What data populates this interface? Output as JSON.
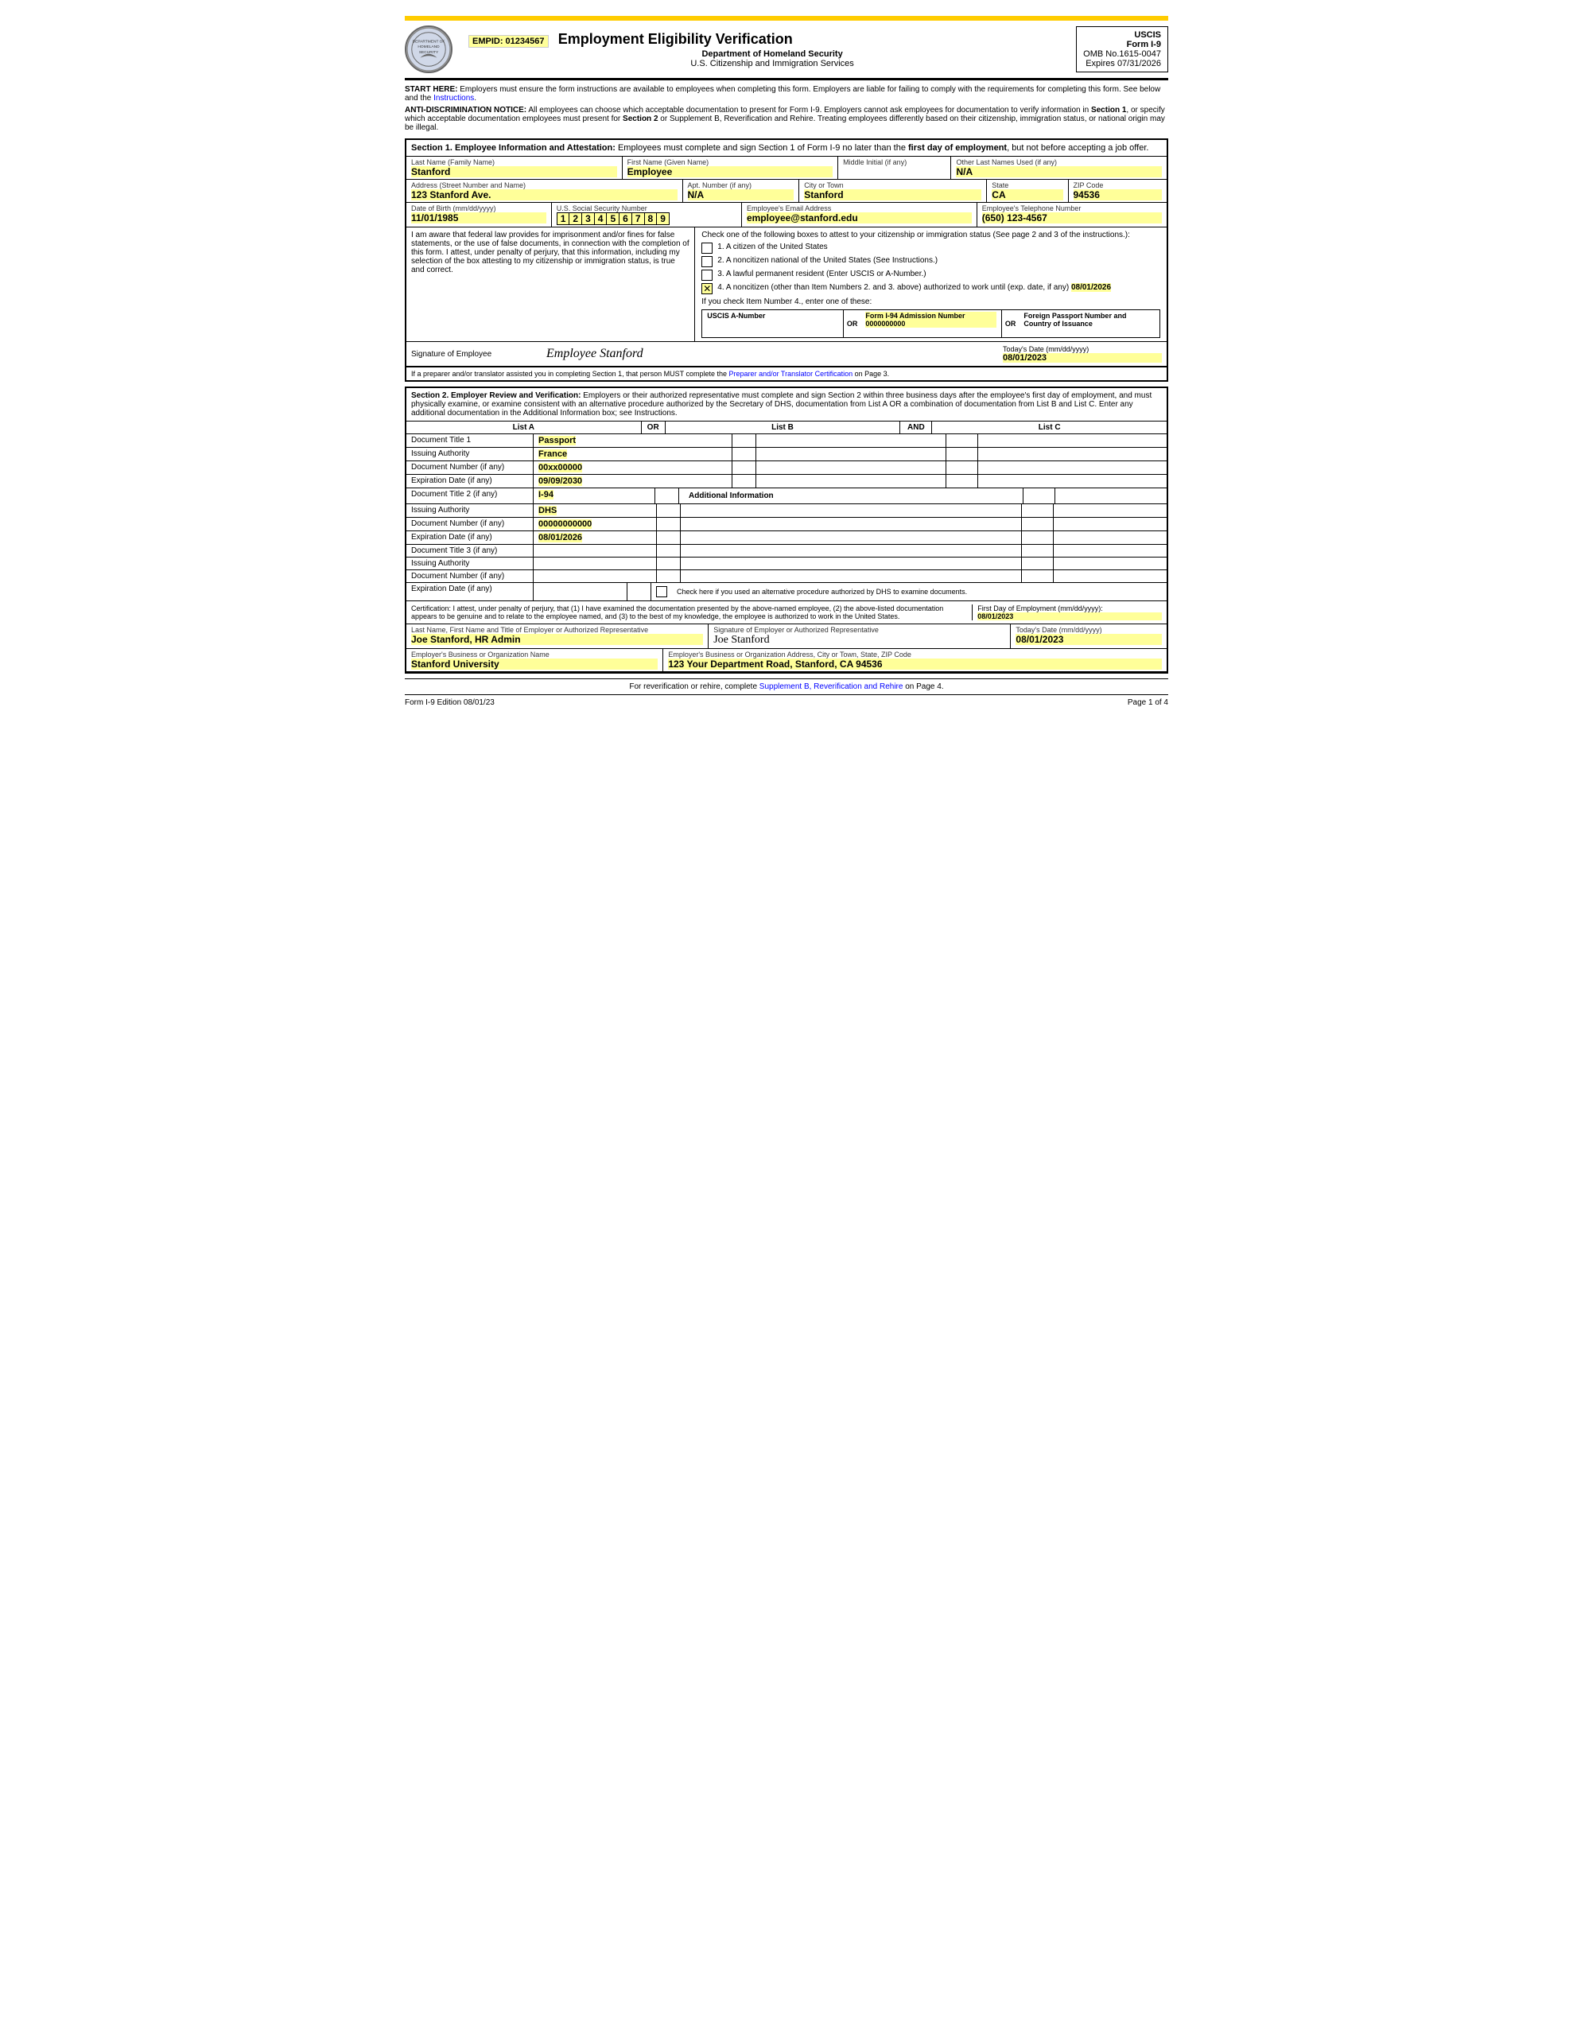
{
  "header": {
    "empid_label": "EMPID: 01234567",
    "title": "Employment Eligibility Verification",
    "dept": "Department of Homeland Security",
    "agency": "U.S. Citizenship and Immigration Services",
    "form_id": "USCIS",
    "form_name": "Form I-9",
    "omb": "OMB No.1615-0047",
    "expires": "Expires 07/31/2026"
  },
  "notices": {
    "start_here": "START HERE:  Employers must ensure the form instructions are available to employees when completing this form.  Employers are liable for failing to comply with the requirements for completing this form.  See below and the Instructions.",
    "anti_discrimination": "ANTI-DISCRIMINATION NOTICE:  All employees can choose which acceptable documentation to present for Form I-9.  Employers cannot ask employees for documentation to verify information in Section 1, or specify which acceptable documentation employees must present for Section 2 or Supplement B, Reverification and Rehire.  Treating employees differently based on their citizenship, immigration status, or national origin may be illegal."
  },
  "section1": {
    "header": "Section 1. Employee Information and Attestation:",
    "header_desc": "Employees must complete and sign Section 1 of Form I-9 no later than the first day of employment, but not before accepting a job offer.",
    "last_name_label": "Last Name (Family Name)",
    "last_name": "Stanford",
    "first_name_label": "First Name (Given Name)",
    "first_name": "Employee",
    "middle_initial_label": "Middle Initial (if any)",
    "middle_initial": "",
    "other_names_label": "Other Last Names Used (if any)",
    "other_names": "N/A",
    "address_label": "Address (Street Number and Name)",
    "address": "123 Stanford Ave.",
    "apt_label": "Apt. Number (if any)",
    "apt": "N/A",
    "city_label": "City or Town",
    "city": "Stanford",
    "state_label": "State",
    "state": "CA",
    "zip_label": "ZIP Code",
    "zip": "94536",
    "dob_label": "Date of Birth (mm/dd/yyyy)",
    "dob": "11/01/1985",
    "ssn_label": "U.S. Social Security Number",
    "ssn_digits": [
      "1",
      "2",
      "3",
      "4",
      "5",
      "6",
      "7",
      "8",
      "9"
    ],
    "email_label": "Employee's Email Address",
    "email": "employee@stanford.edu",
    "phone_label": "Employee's Telephone Number",
    "phone": "(650) 123-4567",
    "attest_left_text": "I am aware that federal law provides for imprisonment and/or fines for false statements, or the use of false documents, in connection with the completion of this form. I attest, under penalty of perjury, that this information, including my selection of the box attesting to my citizenship or immigration status, is true and correct.",
    "checkbox1": "1.  A citizen of the United States",
    "checkbox2": "2.  A noncitizen national of the United States (See Instructions.)",
    "checkbox3": "3.  A lawful permanent resident (Enter USCIS or A-Number.)",
    "checkbox4": "4.  A noncitizen (other than Item Numbers 2. and 3. above) authorized to work until (exp. date, if any)",
    "work_until": "08/01/2026",
    "if_check4": "If you check Item Number 4., enter one of these:",
    "uscis_label": "USCIS A-Number",
    "uscis_value": "",
    "form94_label": "Form I-94 Admission Number",
    "form94_value": "0000000000",
    "passport_label": "Foreign Passport Number and Country of Issuance",
    "passport_value": "",
    "or1": "OR",
    "or2": "OR",
    "sig_label": "Signature of Employee",
    "sig_value": "Employee Stanford",
    "sig_date_label": "Today's Date (mm/dd/yyyy)",
    "sig_date": "08/01/2023",
    "sig_note": "If a preparer and/or translator assisted you in completing Section 1, that person MUST complete the Preparer and/or Translator Certification on Page 3."
  },
  "section2": {
    "header": "Section 2. Employer Review and Verification:",
    "header_desc": "Employers or their authorized representative must complete and sign Section 2 within three business days after the employee's first day of employment, and must physically examine, or examine consistent with an alternative procedure authorized by the Secretary of DHS, documentation from List A OR a combination of documentation from List B and List C.  Enter any additional documentation in the Additional Information box; see Instructions.",
    "list_a_header": "List A",
    "list_b_header": "List B",
    "list_c_header": "List C",
    "or_label": "OR",
    "and_label": "AND",
    "doc1_title_label": "Document Title 1",
    "doc1_title": "Passport",
    "doc1_issuing_label": "Issuing Authority",
    "doc1_issuing": "France",
    "doc1_number_label": "Document Number (if any)",
    "doc1_number": "00xx00000",
    "doc1_expiry_label": "Expiration Date (if any)",
    "doc1_expiry": "09/09/2030",
    "doc2_title_label": "Document Title 2 (if any)",
    "doc2_title": "I-94",
    "doc2_issuing_label": "Issuing Authority",
    "doc2_issuing": "DHS",
    "doc2_number_label": "Document Number (if any)",
    "doc2_number": "00000000000",
    "doc2_expiry_label": "Expiration Date (if any)",
    "doc2_expiry": "08/01/2026",
    "doc3_title_label": "Document Title 3 (if any)",
    "doc3_title": "",
    "doc3_issuing_label": "Issuing Authority",
    "doc3_issuing": "",
    "doc3_number_label": "Document Number (if any)",
    "doc3_number": "",
    "doc3_expiry_label": "Expiration Date (if any)",
    "doc3_expiry": "",
    "additional_info_label": "Additional Information",
    "alt_procedure_text": "Check here if you used an alternative procedure authorized by DHS to examine documents.",
    "cert_text": "Certification: I attest, under penalty of perjury, that (1) I have examined the documentation presented by the above-named employee, (2) the above-listed documentation appears to be genuine and to relate to the employee named, and (3) to the best of my knowledge, the employee is authorized to work in the United States.",
    "first_day_label": "First Day of Employment (mm/dd/yyyy):",
    "first_day": "08/01/2023",
    "employer_name_label": "Last Name, First Name and Title of Employer or Authorized Representative",
    "employer_name": "Joe Stanford, HR Admin",
    "employer_sig_label": "Signature of Employer or Authorized Representative",
    "employer_sig": "Joe Stanford",
    "employer_date_label": "Today's Date (mm/dd/yyyy)",
    "employer_date": "08/01/2023",
    "org_name_label": "Employer's Business or Organization Name",
    "org_name": "Stanford University",
    "org_address_label": "Employer's Business or Organization Address, City or Town, State, ZIP Code",
    "org_address": "123 Your Department Road, Stanford, CA 94536"
  },
  "footer": {
    "supplement_text": "For reverification or rehire, complete Supplement B, Reverification and Rehire on Page 4.",
    "edition": "Form I-9  Edition  08/01/23",
    "page": "Page 1 of 4"
  }
}
